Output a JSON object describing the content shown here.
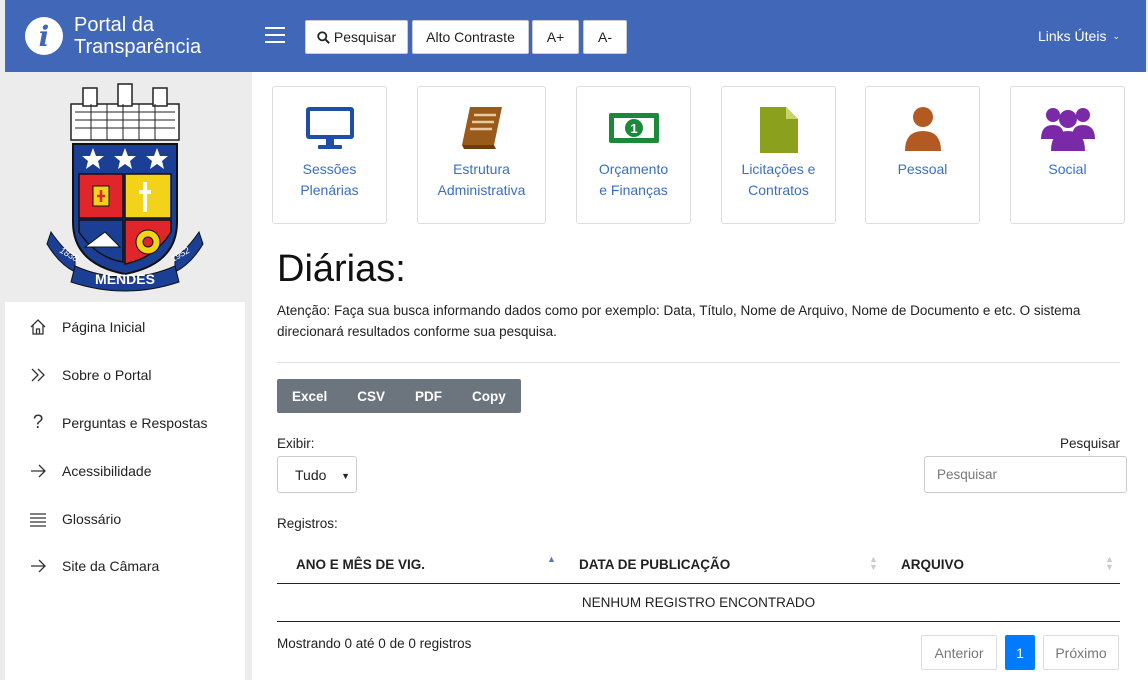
{
  "header": {
    "brand_line1": "Portal da",
    "brand_line2": "Transparência",
    "search_label": "Pesquisar",
    "contrast_label": "Alto Contraste",
    "font_increase_label": "A+",
    "font_decrease_label": "A-",
    "links_label": "Links Úteis",
    "header_color": "#4167b8"
  },
  "sidebar": {
    "logo_text": "MENDES",
    "logo_year_left": "1838",
    "logo_year_right": "1952",
    "items": [
      {
        "label": "Página Inicial",
        "icon": "home-icon"
      },
      {
        "label": "Sobre o Portal",
        "icon": "double-chevron-right-icon"
      },
      {
        "label": "Perguntas e Respostas",
        "icon": "question-icon"
      },
      {
        "label": "Acessibilidade",
        "icon": "arrow-right-icon"
      },
      {
        "label": "Glossário",
        "icon": "list-icon"
      },
      {
        "label": "Site da Câmara",
        "icon": "arrow-right-icon"
      }
    ]
  },
  "tiles": [
    {
      "line1": "Sessões",
      "line2": "Plenárias",
      "icon": "monitor-icon",
      "color": "#1f4ea8"
    },
    {
      "line1": "Estrutura",
      "line2": "Administrativa",
      "icon": "book-icon",
      "color": "#9a5a1a"
    },
    {
      "line1": "Orçamento",
      "line2": "e Finanças",
      "icon": "money-icon",
      "color": "#1a8a3a"
    },
    {
      "line1": "Licitações e",
      "line2": "Contratos",
      "icon": "document-icon",
      "color": "#8ba01c"
    },
    {
      "line1": "Pessoal",
      "line2": "",
      "icon": "person-icon",
      "color": "#b35a23"
    },
    {
      "line1": "Social",
      "line2": "",
      "icon": "group-icon",
      "color": "#7a2aa8"
    }
  ],
  "main": {
    "title": "Diárias:",
    "attention": "Atenção: Faça sua busca informando dados como por exemplo: Data, Título, Nome de Arquivo, Nome de Documento e etc. O sistema direcionará resultados conforme sua pesquisa.",
    "export_buttons": [
      "Excel",
      "CSV",
      "PDF",
      "Copy"
    ],
    "show_label": "Exibir:",
    "show_value": "Tudo",
    "search_label": "Pesquisar",
    "search_placeholder": "Pesquisar",
    "records_label": "Registros:",
    "columns": [
      "ANO E MÊS DE VIG.",
      "DATA DE PUBLICAÇÃO",
      "ARQUIVO"
    ],
    "empty_message": "NENHUM REGISTRO ENCONTRADO",
    "info": "Mostrando 0 até 0 de 0 registros",
    "pagination": {
      "prev": "Anterior",
      "current": "1",
      "next": "Próximo"
    }
  }
}
